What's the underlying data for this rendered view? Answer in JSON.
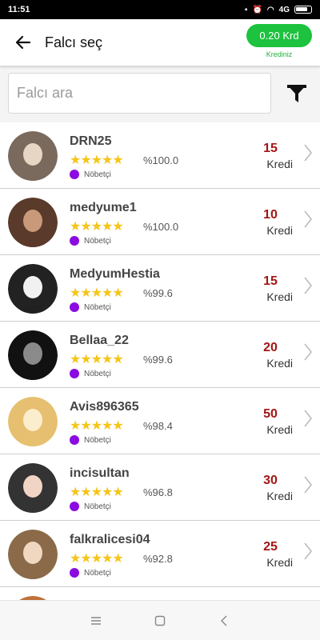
{
  "status_bar": {
    "time": "11:51",
    "signal": "4G"
  },
  "header": {
    "title": "Falcı seç",
    "credit_amount": "0.20 Krd",
    "credit_caption": "Krediniz"
  },
  "search": {
    "placeholder": "Falcı ara"
  },
  "icons": {
    "back": "arrow-left-icon",
    "filter": "filter-icon",
    "chevron": "chevron-right-icon"
  },
  "colors": {
    "accent": "#1dc23f",
    "price": "#a31515",
    "status_dot": "#8a0ce0",
    "star": "#f5c518"
  },
  "readers": [
    {
      "name": "DRN25",
      "stars": "★★★★★",
      "rating": "%100.0",
      "status": "Nöbetçi",
      "price": "15",
      "unit": "Kredi"
    },
    {
      "name": "medyume1",
      "stars": "★★★★★",
      "rating": "%100.0",
      "status": "Nöbetçi",
      "price": "10",
      "unit": "Kredi"
    },
    {
      "name": "MedyumHestia",
      "stars": "★★★★★",
      "rating": "%99.6",
      "status": "Nöbetçi",
      "price": "15",
      "unit": "Kredi"
    },
    {
      "name": "Bellaa_22",
      "stars": "★★★★★",
      "rating": "%99.6",
      "status": "Nöbetçi",
      "price": "20",
      "unit": "Kredi"
    },
    {
      "name": "Avis896365",
      "stars": "★★★★★",
      "rating": "%98.4",
      "status": "Nöbetçi",
      "price": "50",
      "unit": "Kredi"
    },
    {
      "name": "incisultan",
      "stars": "★★★★★",
      "rating": "%96.8",
      "status": "Nöbetçi",
      "price": "30",
      "unit": "Kredi"
    },
    {
      "name": "falkralicesi04",
      "stars": "★★★★★",
      "rating": "%92.8",
      "status": "Nöbetçi",
      "price": "25",
      "unit": "Kredi"
    }
  ]
}
